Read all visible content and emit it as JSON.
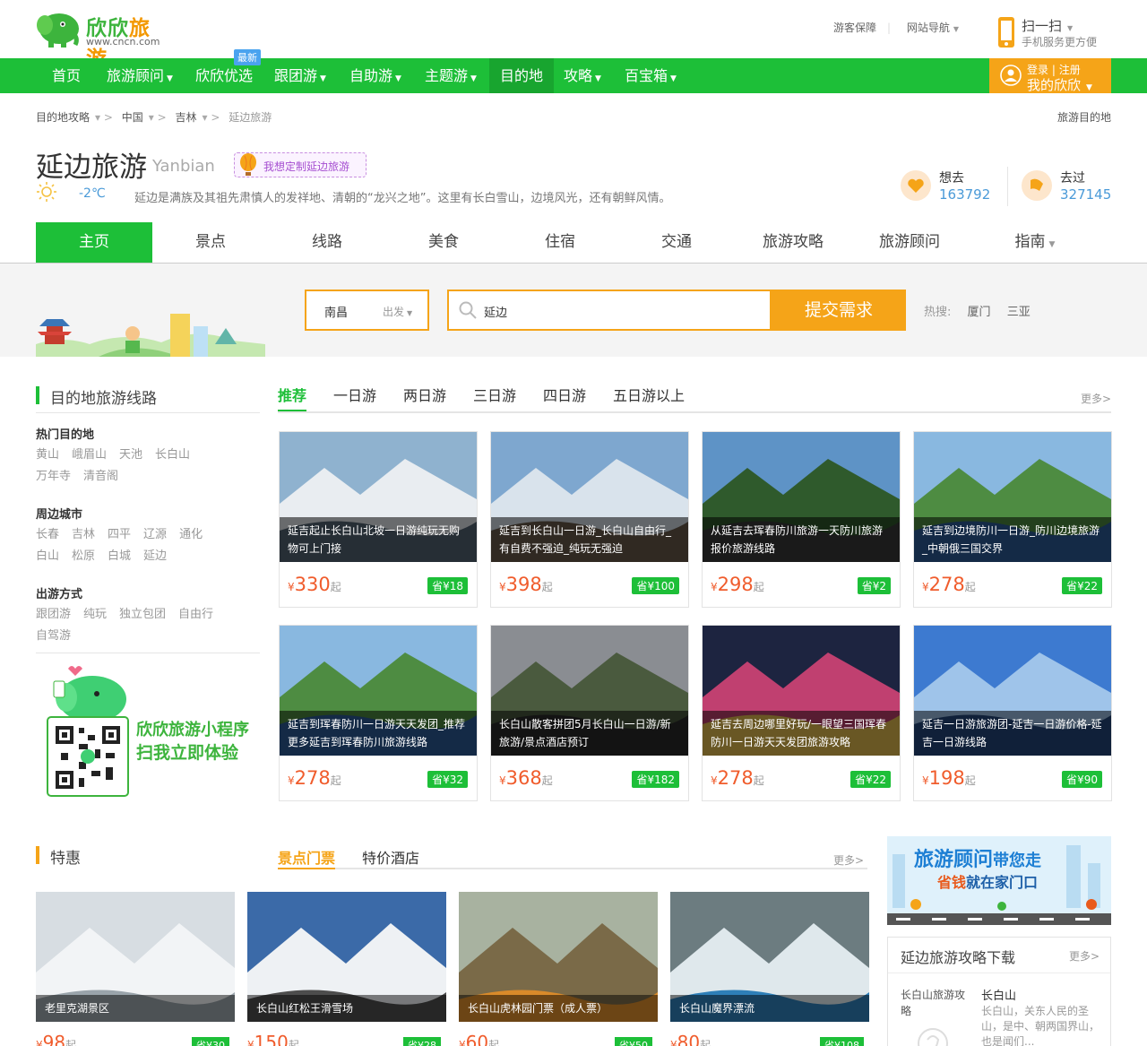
{
  "header": {
    "logo_text_a": "欣欣",
    "logo_text_b": "旅游",
    "logo_url": "www.cncn.com",
    "links": [
      "游客保障",
      "网站导航"
    ],
    "scan_title": "扫一扫",
    "scan_sub": "手机服务更方便"
  },
  "nav": {
    "items": [
      "首页",
      "旅游顾问",
      "欣欣优选",
      "跟团游",
      "自助游",
      "主题游",
      "目的地",
      "攻略",
      "百宝箱"
    ],
    "new_badge": "最新",
    "login": "登录",
    "register": "注册",
    "my": "我的欣欣"
  },
  "breadcrumb": {
    "items": [
      "目的地攻略",
      "中国",
      "吉林",
      "延边旅游"
    ],
    "right": "旅游目的地"
  },
  "destination": {
    "title": "延边旅游",
    "pinyin": "Yanbian",
    "custom_label": "我想定制延边旅游",
    "temp": "-2℃",
    "desc": "延边是满族及其祖先肃慎人的发祥地、清朝的“龙兴之地”。这里有长白雪山，边境风光，还有朝鲜风情。",
    "want_label": "想去",
    "want_count": "163792",
    "been_label": "去过",
    "been_count": "327145"
  },
  "tabs": [
    "主页",
    "景点",
    "线路",
    "美食",
    "住宿",
    "交通",
    "旅游攻略",
    "旅游顾问",
    "指南"
  ],
  "search": {
    "from_city": "南昌",
    "from_label": "出发",
    "query": "延边",
    "submit": "提交需求",
    "hot_label": "热搜:",
    "hot": [
      "厦门",
      "三亚"
    ]
  },
  "routes": {
    "title": "目的地旅游线路",
    "subtabs": [
      "推荐",
      "一日游",
      "两日游",
      "三日游",
      "四日游",
      "五日游以上"
    ],
    "more": "更多>",
    "cards": [
      {
        "title": "延吉起止长白山北坡一日游纯玩无购物可上门接",
        "price": "330",
        "save": "省¥18"
      },
      {
        "title": "延吉到长白山一日游_长白山自由行_有自费不强迫_纯玩无强迫",
        "price": "398",
        "save": "省¥100"
      },
      {
        "title": "从延吉去珲春防川旅游一天防川旅游报价旅游线路",
        "price": "298",
        "save": "省¥2"
      },
      {
        "title": "延吉到边境防川一日游_防川边境旅游_中朝俄三国交界",
        "price": "278",
        "save": "省¥22"
      },
      {
        "title": "延吉到珲春防川一日游天天发团_推荐更多延吉到珲春防川旅游线路",
        "price": "278",
        "save": "省¥32"
      },
      {
        "title": "长白山散客拼团5月长白山一日游/新旅游/景点酒店预订",
        "price": "368",
        "save": "省¥182"
      },
      {
        "title": "延吉去周边哪里好玩/一眼望三国珲春防川一日游天天发团旅游攻略",
        "price": "278",
        "save": "省¥22"
      },
      {
        "title": "延吉一日游旅游团-延吉一日游价格-延吉一日游线路",
        "price": "198",
        "save": "省¥90"
      }
    ],
    "currency": "¥",
    "unit": "起"
  },
  "sidebar": {
    "hot_title": "热门目的地",
    "hot": [
      "黄山",
      "峨眉山",
      "天池",
      "长白山",
      "万年寺",
      "清音阁"
    ],
    "city_title": "周边城市",
    "cities": [
      "长春",
      "吉林",
      "四平",
      "辽源",
      "通化",
      "白山",
      "松原",
      "白城",
      "延边"
    ],
    "way_title": "出游方式",
    "ways": [
      "跟团游",
      "纯玩",
      "独立包团",
      "自由行",
      "自驾游"
    ]
  },
  "mini": {
    "line1": "欣欣旅游小程序",
    "line2": "扫我立即体验"
  },
  "deals": {
    "title": "特惠",
    "subtabs": [
      "景点门票",
      "特价酒店"
    ],
    "more": "更多>",
    "cards": [
      {
        "title": "老里克湖景区",
        "price": "98",
        "save": "省¥30"
      },
      {
        "title": "长白山红松王滑雪场",
        "price": "150",
        "save": "省¥28"
      },
      {
        "title": "长白山虎林园门票（成人票）",
        "price": "60",
        "save": "省¥50"
      },
      {
        "title": "长白山魔界漂流",
        "price": "80",
        "save": "省¥108"
      }
    ]
  },
  "right": {
    "banner_line1_a": "旅游顾问",
    "banner_line1_b": "带您走",
    "banner_line2_a": "省钱",
    "banner_line2_b": "就在家门口",
    "guide_title": "延边旅游攻略下载",
    "guide_more": "更多>",
    "guide_book": "长白山旅游攻略",
    "guide_name": "长白山",
    "guide_desc": "长白山，关东人民的圣山，是中、朝两国界山，也是闻们..."
  },
  "colors": {
    "green": "#1dbf38",
    "orange": "#f5a418",
    "price": "#f05c2c",
    "blue": "#4a9ad8"
  }
}
